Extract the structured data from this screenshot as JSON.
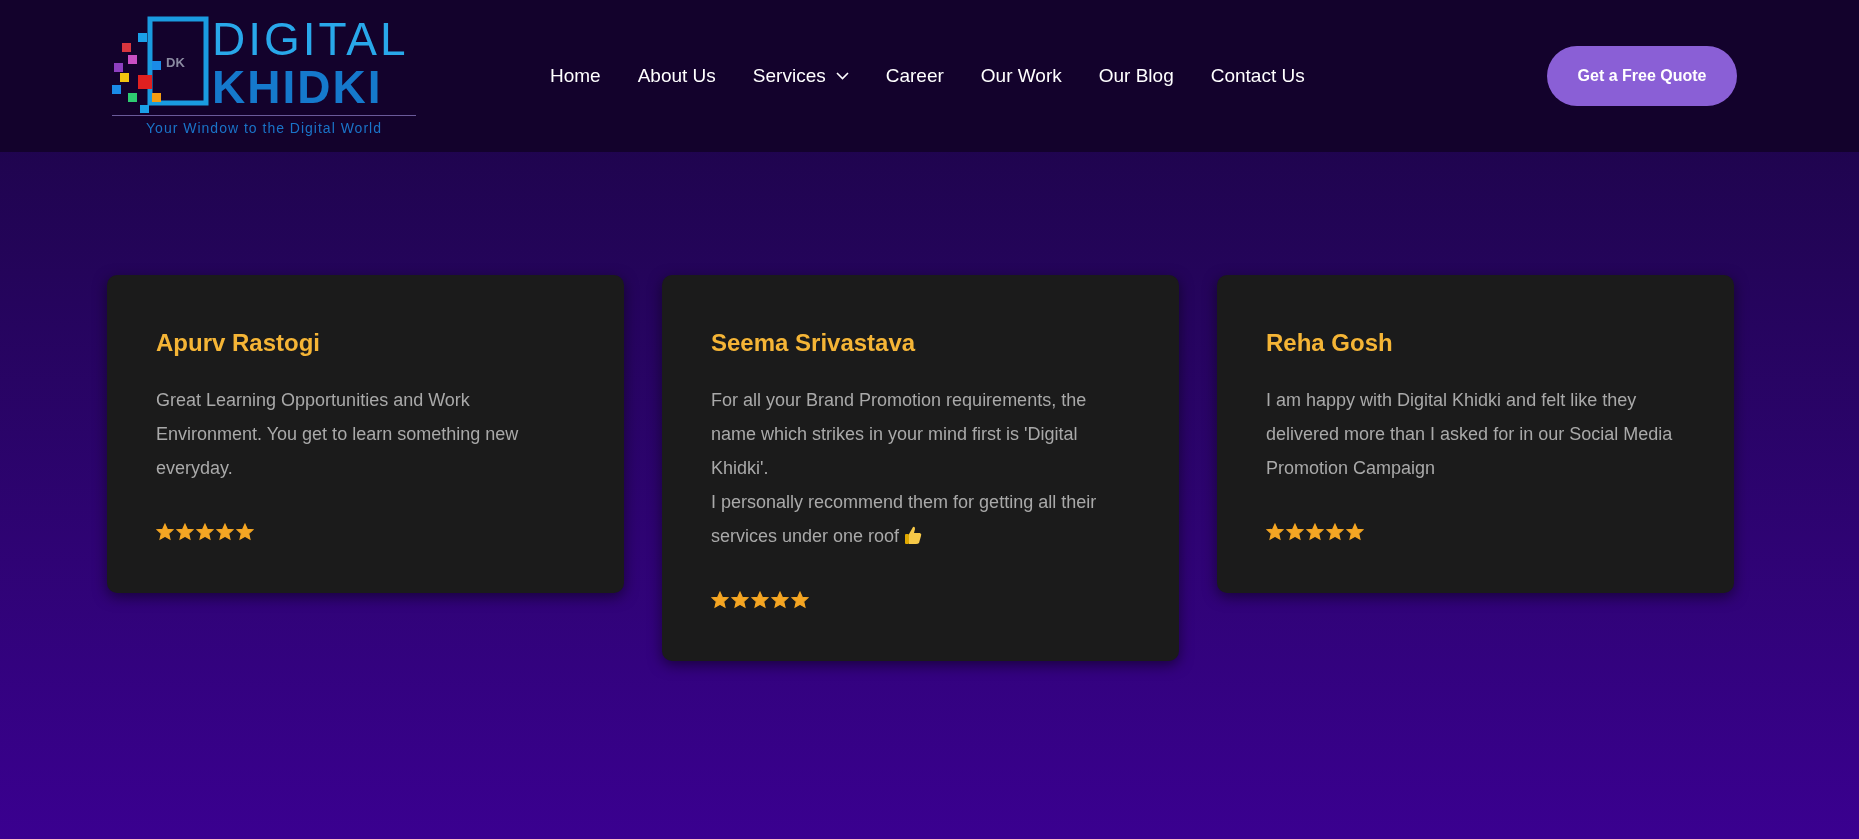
{
  "header": {
    "logo": {
      "mark_text": "DK",
      "line_1": "DIGITAL",
      "line_2": "KHIDKI",
      "tagline": "Your Window to the Digital World"
    },
    "nav": [
      {
        "label": "Home",
        "has_dropdown": false
      },
      {
        "label": "About Us",
        "has_dropdown": false
      },
      {
        "label": "Services",
        "has_dropdown": true
      },
      {
        "label": "Career",
        "has_dropdown": false
      },
      {
        "label": "Our Work",
        "has_dropdown": false
      },
      {
        "label": "Our Blog",
        "has_dropdown": false
      },
      {
        "label": "Contact Us",
        "has_dropdown": false
      }
    ],
    "cta_button": "Get a Free Quote"
  },
  "testimonials": [
    {
      "name": "Apurv Rastogi",
      "text": "Great Learning Opportunities and Work Environment. You get to learn something new everyday.",
      "thumbs_up": false,
      "stars": 5
    },
    {
      "name": "Seema Srivastava",
      "text": "For all your Brand Promotion requirements, the name which strikes in your mind first is 'Digital Khidki'.\nI personally recommend them for getting all their services under one roof",
      "thumbs_up": true,
      "stars": 5
    },
    {
      "name": "Reha Gosh",
      "text": "I am happy with Digital Khidki and felt like they delivered more than I asked for in our Social Media Promotion Campaign",
      "thumbs_up": false,
      "stars": 5
    }
  ]
}
